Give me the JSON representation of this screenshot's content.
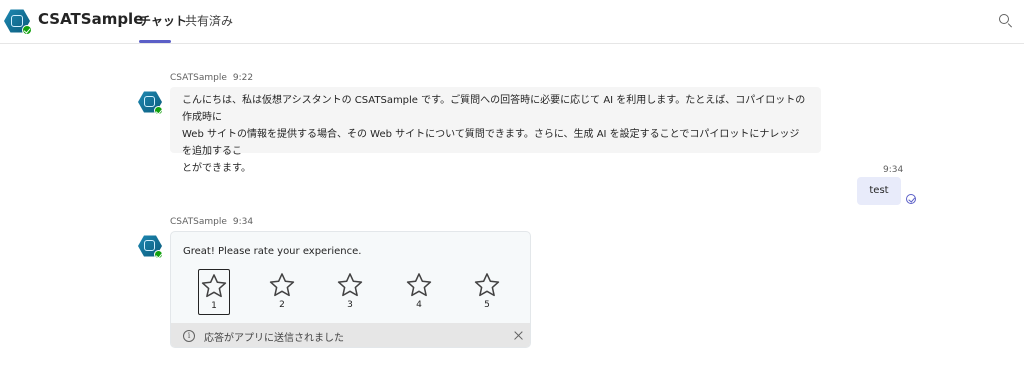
{
  "header": {
    "app_title": "CSATSample",
    "tabs": [
      {
        "label": "チャット",
        "active": true
      },
      {
        "label": "共有済み",
        "active": false
      }
    ],
    "search_icon": "search-icon",
    "accent_color": "#5b5fc7"
  },
  "messages": [
    {
      "sender": "CSATSample",
      "time": "9:22",
      "lines": [
        "こんにちは、私は仮想アシスタントの CSATSample です。ご質問への回答時に必要に応じて AI を利用します。たとえば、コパイロットの作成時に",
        "Web サイトの情報を提供する場合、その Web サイトについて質問できます。さらに、生成 AI を設定することでコパイロットにナレッジを追加するこ",
        "とができます。"
      ]
    },
    {
      "sender": "me",
      "time": "9:34",
      "text": "test",
      "status_icon": "read-receipt-icon"
    },
    {
      "sender": "CSATSample",
      "time": "9:34",
      "card": {
        "prompt": "Great! Please rate your experience.",
        "ratings": [
          "1",
          "2",
          "3",
          "4",
          "5"
        ],
        "selected_rating": "1",
        "notice": "応答がアプリに送信されました",
        "notice_icon": "info-icon",
        "close_icon": "close-icon"
      }
    }
  ]
}
